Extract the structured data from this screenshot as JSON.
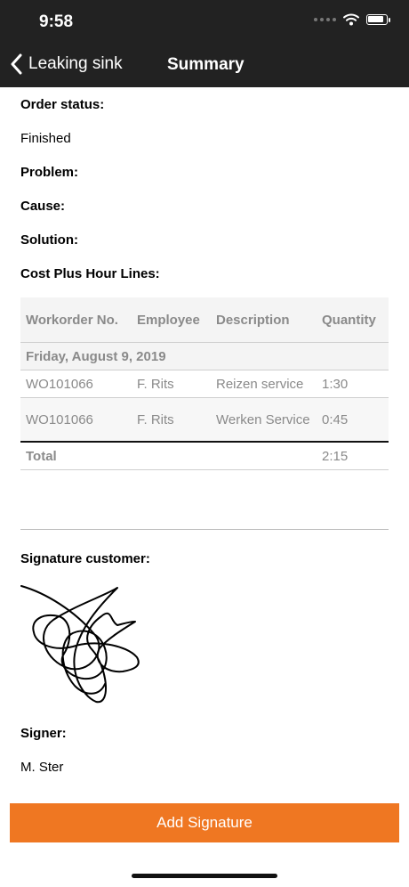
{
  "status_bar": {
    "time": "9:58"
  },
  "nav": {
    "back_label": "Leaking sink",
    "title": "Summary"
  },
  "fields": {
    "order_status_label": "Order status:",
    "order_status_value": "Finished",
    "problem_label": "Problem:",
    "cause_label": "Cause:",
    "solution_label": "Solution:",
    "cost_lines_label": "Cost Plus Hour Lines:"
  },
  "table": {
    "headers": {
      "workorder": "Workorder No.",
      "employee": "Employee",
      "description": "Description",
      "quantity": "Quantity"
    },
    "date_row": "Friday, August 9, 2019",
    "rows": [
      {
        "workorder": "WO101066",
        "employee": "F. Rits",
        "description": "Reizen service",
        "quantity": "1:30"
      },
      {
        "workorder": "WO101066",
        "employee": "F. Rits",
        "description": "Werken Service",
        "quantity": "0:45"
      }
    ],
    "total_label": "Total",
    "total_quantity": "2:15"
  },
  "signature": {
    "label": "Signature customer:"
  },
  "signer": {
    "label": "Signer:",
    "value": "M. Ster"
  },
  "actions": {
    "add_signature_label": "Add Signature"
  },
  "colors": {
    "topbar": "#222222",
    "accent": "#ef7722"
  }
}
